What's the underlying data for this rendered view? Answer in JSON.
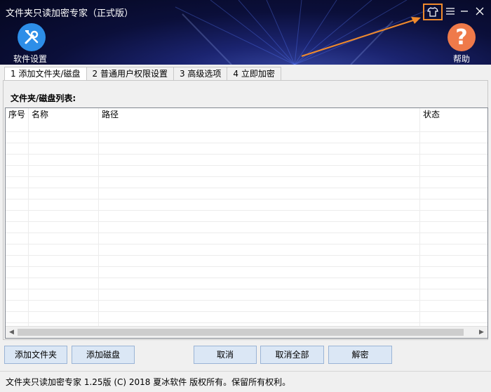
{
  "app": {
    "title": "文件夹只读加密专家（正式版）",
    "settings_label": "软件设置",
    "help_label": "帮助",
    "help_glyph": "?",
    "accent_arrow_color": "#f08a2c"
  },
  "window_controls": {
    "skin_icon": "tshirt-icon",
    "menu_icon": "hamburger-icon",
    "minimize_icon": "minimize-icon",
    "close_icon": "close-icon"
  },
  "tabs": [
    {
      "label": "1 添加文件夹/磁盘",
      "active": true
    },
    {
      "label": "2 普通用户权限设置",
      "active": false
    },
    {
      "label": "3 高级选项",
      "active": false
    },
    {
      "label": "4 立即加密",
      "active": false
    }
  ],
  "list": {
    "title": "文件夹/磁盘列表:",
    "columns": [
      "序号",
      "名称",
      "路径",
      "状态"
    ],
    "rows": []
  },
  "buttons": {
    "add_folder": "添加文件夹",
    "add_disk": "添加磁盘",
    "cancel": "取消",
    "cancel_all": "取消全部",
    "decrypt": "解密"
  },
  "status": {
    "text": "文件夹只读加密专家 1.25版 (C) 2018 夏冰软件 版权所有。保留所有权利。"
  }
}
